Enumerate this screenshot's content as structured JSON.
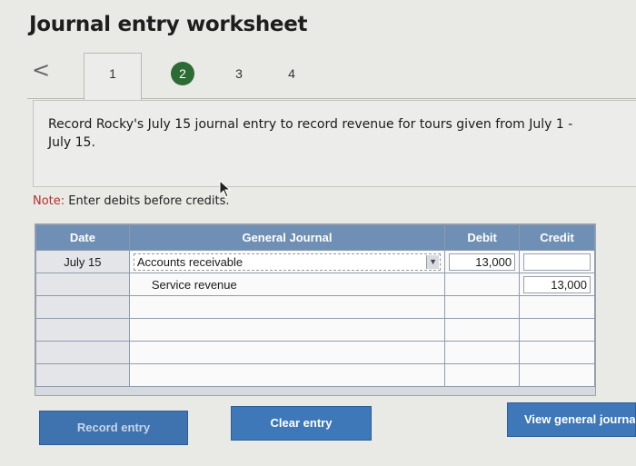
{
  "header": {
    "title": "Journal entry worksheet"
  },
  "nav": {
    "back_glyph": "<",
    "tabs": [
      {
        "label": "1",
        "state": "visited"
      },
      {
        "label": "2",
        "state": "current"
      },
      {
        "label": "3",
        "state": "pending"
      },
      {
        "label": "4",
        "state": "pending"
      }
    ]
  },
  "prompt": {
    "text": "Record Rocky's July 15 journal entry to record revenue for tours given from July 1 - July 15."
  },
  "note": {
    "label": "Note:",
    "text": " Enter debits before credits."
  },
  "journal": {
    "headers": {
      "date": "Date",
      "account": "General Journal",
      "debit": "Debit",
      "credit": "Credit"
    },
    "rows": [
      {
        "date": "July 15",
        "account": "Accounts receivable",
        "debit": "13,000",
        "credit": ""
      },
      {
        "date": "",
        "account": "Service revenue",
        "debit": "",
        "credit": "13,000"
      },
      {
        "date": "",
        "account": "",
        "debit": "",
        "credit": ""
      },
      {
        "date": "",
        "account": "",
        "debit": "",
        "credit": ""
      },
      {
        "date": "",
        "account": "",
        "debit": "",
        "credit": ""
      },
      {
        "date": "",
        "account": "",
        "debit": "",
        "credit": ""
      }
    ]
  },
  "actions": {
    "record": "Record entry",
    "clear": "Clear entry",
    "view": "View general journal"
  },
  "colors": {
    "accent": "#3f78b8",
    "step_current": "#2d6b35",
    "note_label": "#b5322d",
    "table_header": "#6f8fb5"
  }
}
